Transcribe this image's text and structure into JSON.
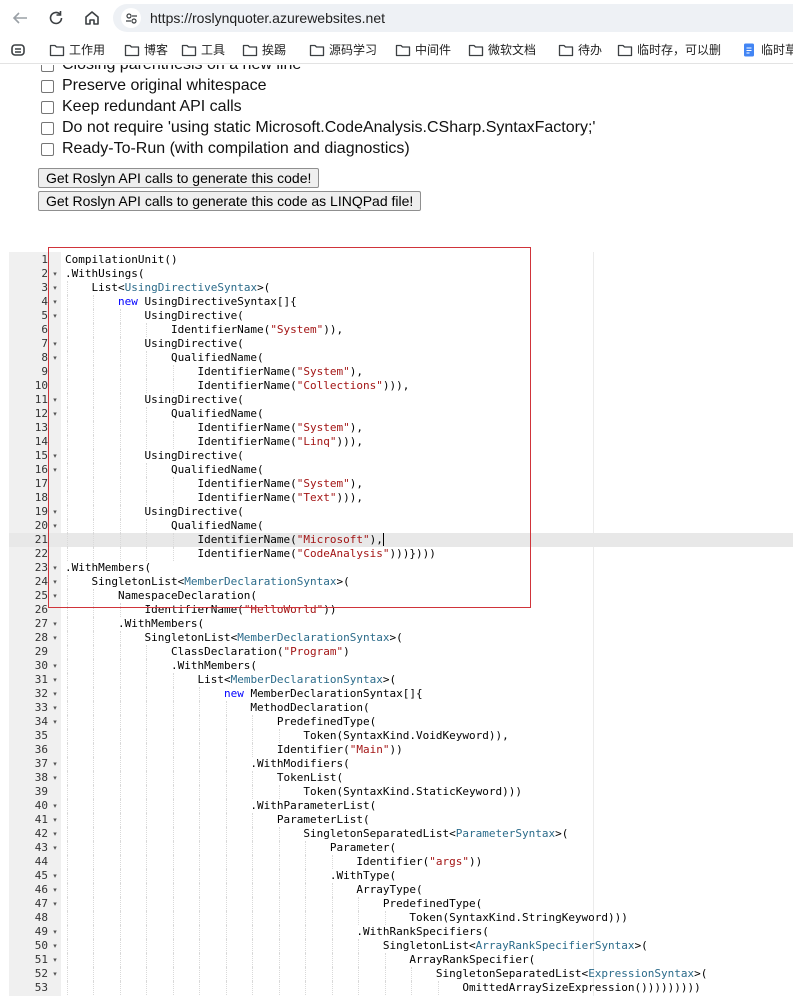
{
  "browser": {
    "url": "https://roslynquoter.azurewebsites.net",
    "bookmarks": [
      {
        "label": "工作用",
        "icon": "folder-icon"
      },
      {
        "label": "博客",
        "icon": "folder-icon"
      },
      {
        "label": "工具",
        "icon": "folder-icon"
      },
      {
        "label": "挨踢",
        "icon": "folder-icon"
      },
      {
        "label": "源码学习",
        "icon": "folder-icon"
      },
      {
        "label": "中间件",
        "icon": "folder-icon"
      },
      {
        "label": "微软文档",
        "icon": "folder-icon"
      },
      {
        "label": "待办",
        "icon": "folder-icon"
      },
      {
        "label": "临时存，可以删",
        "icon": "folder-icon"
      },
      {
        "label": "临时草",
        "icon": "doc-icon"
      }
    ]
  },
  "options": [
    {
      "label": "Closing parenthesis on a new line",
      "checked": false
    },
    {
      "label": "Preserve original whitespace",
      "checked": false
    },
    {
      "label": "Keep redundant API calls",
      "checked": false
    },
    {
      "label": "Do not require 'using static Microsoft.CodeAnalysis.CSharp.SyntaxFactory;'",
      "checked": false
    },
    {
      "label": "Ready-To-Run (with compilation and diagnostics)",
      "checked": false
    }
  ],
  "buttons": {
    "generate": "Get Roslyn API calls to generate this code!",
    "generate_linqpad": "Get Roslyn API calls to generate this code as LINQPad file!"
  },
  "editor": {
    "active_line": 21,
    "lines": [
      "CompilationUnit()",
      ".WithUsings(",
      "    List<UsingDirectiveSyntax>(",
      "        new UsingDirectiveSyntax[]{",
      "            UsingDirective(",
      "                IdentifierName(\"System\")),",
      "            UsingDirective(",
      "                QualifiedName(",
      "                    IdentifierName(\"System\"),",
      "                    IdentifierName(\"Collections\"))),",
      "            UsingDirective(",
      "                QualifiedName(",
      "                    IdentifierName(\"System\"),",
      "                    IdentifierName(\"Linq\"))),",
      "            UsingDirective(",
      "                QualifiedName(",
      "                    IdentifierName(\"System\"),",
      "                    IdentifierName(\"Text\"))),",
      "            UsingDirective(",
      "                QualifiedName(",
      "                    IdentifierName(\"Microsoft\"),",
      "                    IdentifierName(\"CodeAnalysis\")))})))",
      ".WithMembers(",
      "    SingletonList<MemberDeclarationSyntax>(",
      "        NamespaceDeclaration(",
      "            IdentifierName(\"HelloWorld\"))",
      "        .WithMembers(",
      "            SingletonList<MemberDeclarationSyntax>(",
      "                ClassDeclaration(\"Program\")",
      "                .WithMembers(",
      "                    List<MemberDeclarationSyntax>(",
      "                        new MemberDeclarationSyntax[]{",
      "                            MethodDeclaration(",
      "                                PredefinedType(",
      "                                    Token(SyntaxKind.VoidKeyword)),",
      "                                Identifier(\"Main\"))",
      "                            .WithModifiers(",
      "                                TokenList(",
      "                                    Token(SyntaxKind.StaticKeyword)))",
      "                            .WithParameterList(",
      "                                ParameterList(",
      "                                    SingletonSeparatedList<ParameterSyntax>(",
      "                                        Parameter(",
      "                                            Identifier(\"args\"))",
      "                                        .WithType(",
      "                                            ArrayType(",
      "                                                PredefinedType(",
      "                                                    Token(SyntaxKind.StringKeyword)))",
      "                                            .WithRankSpecifiers(",
      "                                                SingletonList<ArrayRankSpecifierSyntax>(",
      "                                                    ArrayRankSpecifier(",
      "                                                        SingletonSeparatedList<ExpressionSyntax>(",
      "                                                            OmittedArraySizeExpression()))))))))"
    ]
  }
}
